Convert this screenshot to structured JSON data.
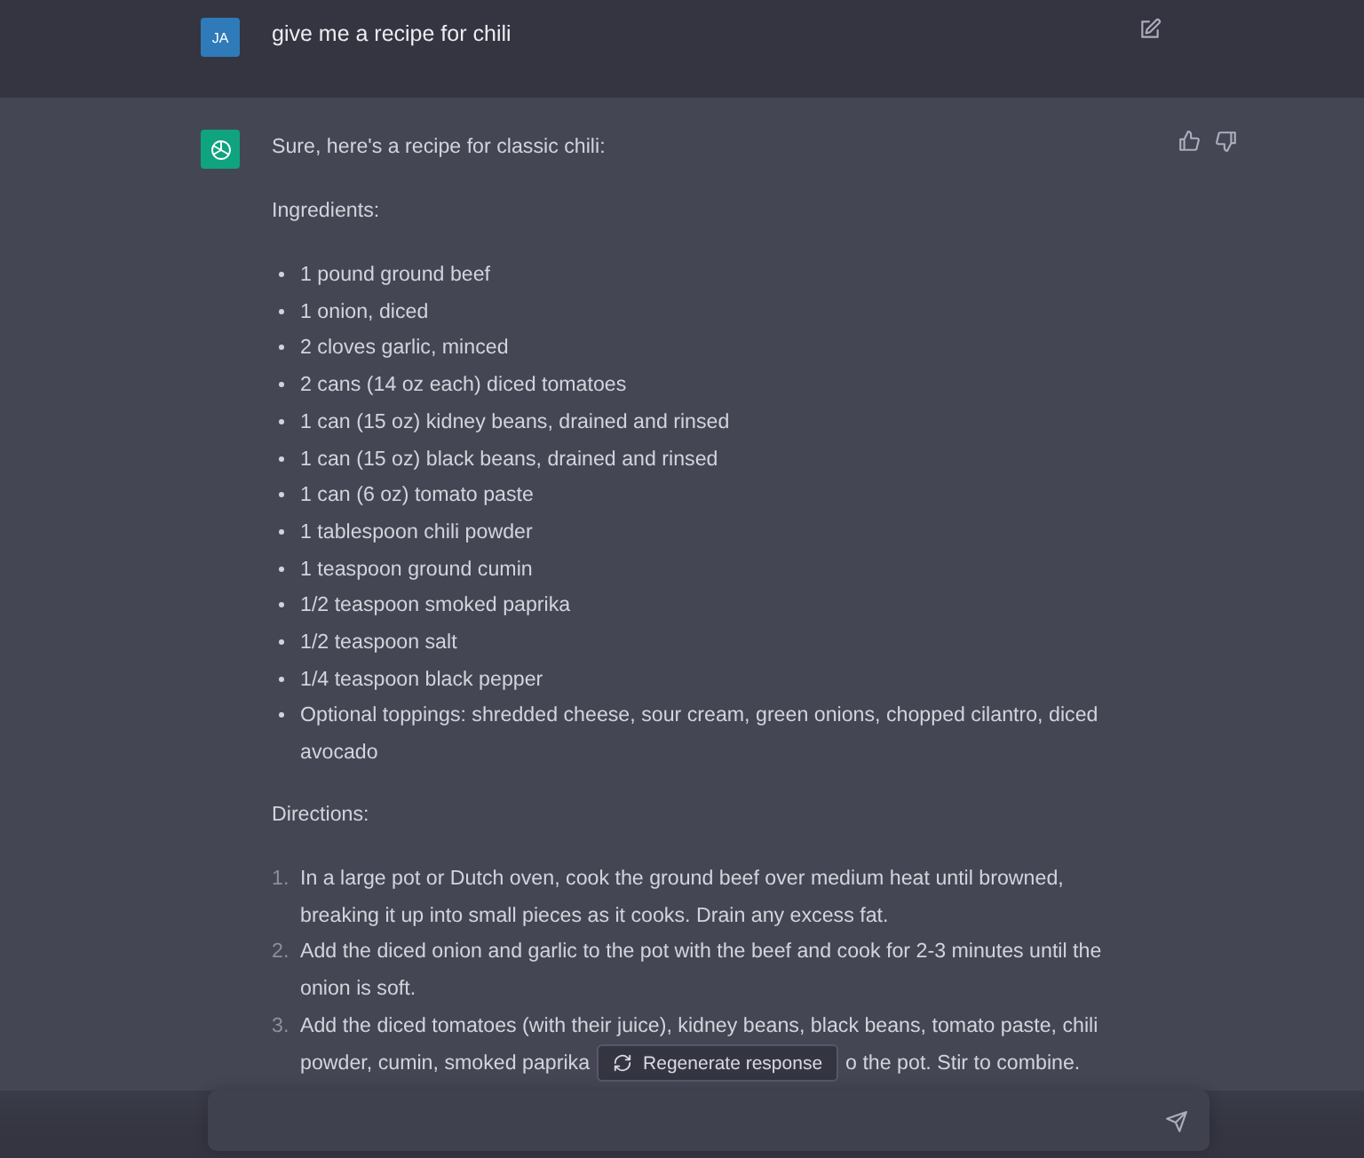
{
  "user_message": {
    "avatar": "JA",
    "text": "give me a recipe for chili"
  },
  "assistant_message": {
    "intro": "Sure, here's a recipe for classic chili:",
    "ingredients_heading": "Ingredients:",
    "ingredients": [
      "1 pound ground beef",
      "1 onion, diced",
      "2 cloves garlic, minced",
      "2 cans (14 oz each) diced tomatoes",
      "1 can (15 oz) kidney beans, drained and rinsed",
      "1 can (15 oz) black beans, drained and rinsed",
      "1 can (6 oz) tomato paste",
      "1 tablespoon chili powder",
      "1 teaspoon ground cumin",
      "1/2 teaspoon smoked paprika",
      "1/2 teaspoon salt",
      "1/4 teaspoon black pepper",
      "Optional toppings: shredded cheese, sour cream, green onions, chopped cilantro, diced avocado"
    ],
    "directions_heading": "Directions:",
    "directions": [
      {
        "number": "1.",
        "text": "In a large pot or Dutch oven, cook the ground beef over medium heat until browned, breaking it up into small pieces as it cooks. Drain any excess fat."
      },
      {
        "number": "2.",
        "text": "Add the diced onion and garlic to the pot with the beef and cook for 2-3 minutes until the onion is soft."
      },
      {
        "number": "3.",
        "text": "Add the diced tomatoes (with their juice), kidney beans, black beans, tomato paste, chili",
        "continuation": "powder, cumin, smoked paprika",
        "tail": "o the pot. Stir to combine."
      }
    ]
  },
  "regenerate_button": "Regenerate response"
}
